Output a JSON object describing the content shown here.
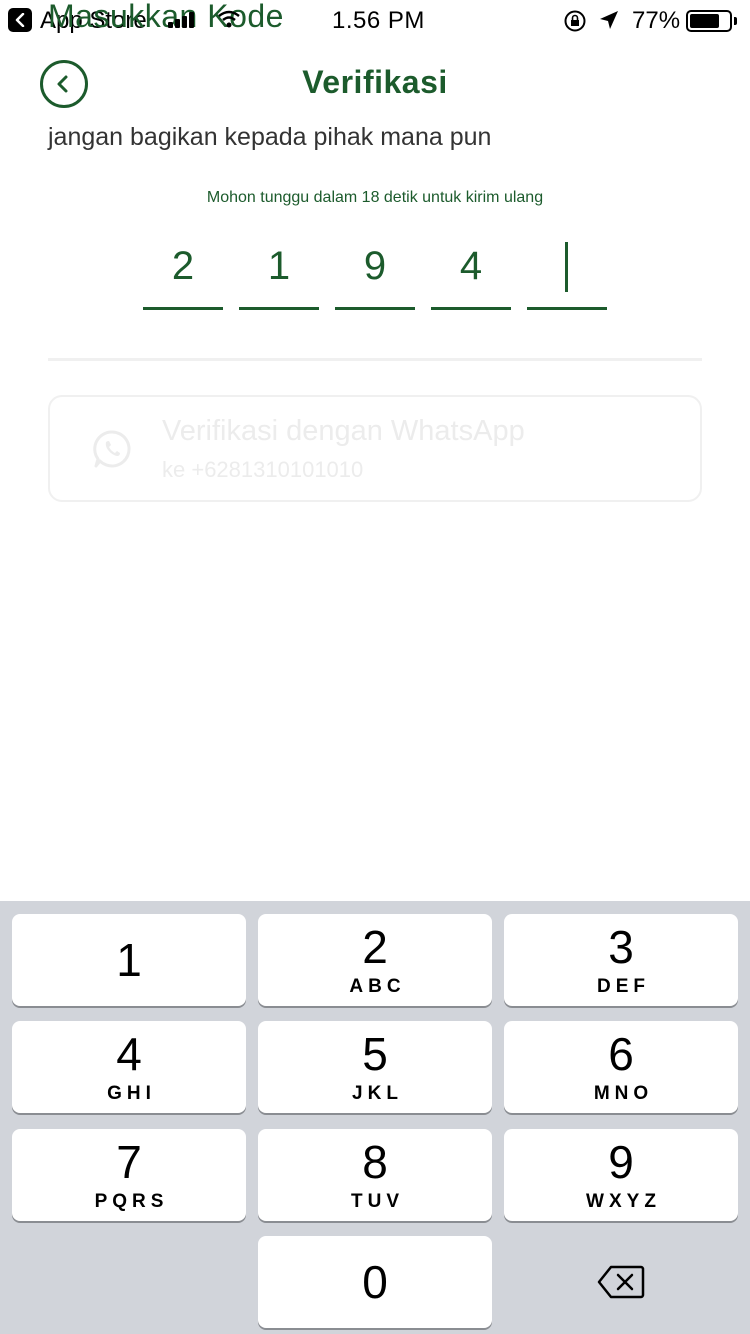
{
  "status_bar": {
    "back_app": "App Store",
    "overlay_title": "Masukkan Kode",
    "time": "1.56 PM",
    "battery_percent": "77%",
    "battery_level": 0.77
  },
  "header": {
    "title": "Verifikasi",
    "subtitle": "jangan bagikan kepada pihak mana pun"
  },
  "resend": {
    "message": "Mohon tunggu dalam 18 detik untuk kirim ulang"
  },
  "otp": {
    "digits": [
      "2",
      "1",
      "9",
      "4",
      ""
    ],
    "accent": "#1c5b2c"
  },
  "whatsapp_option": {
    "title": "Verifikasi dengan WhatsApp",
    "phone": "ke +6281310101010",
    "icon": "whatsapp-icon"
  },
  "keypad": {
    "keys": [
      {
        "num": "1",
        "letters": ""
      },
      {
        "num": "2",
        "letters": "ABC"
      },
      {
        "num": "3",
        "letters": "DEF"
      },
      {
        "num": "4",
        "letters": "GHI"
      },
      {
        "num": "5",
        "letters": "JKL"
      },
      {
        "num": "6",
        "letters": "MNO"
      },
      {
        "num": "7",
        "letters": "PQRS"
      },
      {
        "num": "8",
        "letters": "TUV"
      },
      {
        "num": "9",
        "letters": "WXYZ"
      },
      {
        "num": "0",
        "letters": ""
      }
    ],
    "delete_icon": "backspace-icon"
  },
  "colors": {
    "brand_green": "#1c5b2c",
    "keypad_bg": "#d1d4da"
  }
}
